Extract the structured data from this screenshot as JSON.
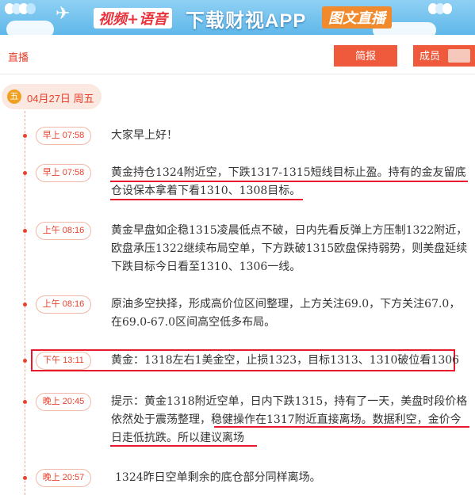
{
  "banner": {
    "slogan_left": "视频+语音",
    "slogan_main": "下载财视APP",
    "slogan_right": "图文直播",
    "plane_icon": "airplane-icon",
    "balloon_icon": "balloons-icon"
  },
  "header": {
    "title": "直播",
    "brief_button": "简报",
    "member_button": "成员"
  },
  "date": {
    "weekday_badge": "五",
    "date_text": "04月27日 周五"
  },
  "colors": {
    "accent": "#e8412c",
    "button_bg": "#f05a3c",
    "annotation_red": "#e8192c"
  },
  "entries": [
    {
      "time": "早上 07:58",
      "text": "大家早上好！"
    },
    {
      "time": "早上 07:58",
      "text": "黄金持仓1324附近空，下跌1317-1315短线目标止盈。持有的金友留底仓设保本拿着下看1310、1308目标。"
    },
    {
      "time": "上午 08:16",
      "text": "黄金早盘如企稳1315凌晨低点不破，日内先看反弹上方压制1322附近，欧盘承压1322继续布局空单，下方跌破1315欧盘保持弱势，则美盘延续下跌目标今日看至1310、1306一线。"
    },
    {
      "time": "上午 08:16",
      "text": "原油多空抉择，形成高价位区间整理，上方关注69.0，下方关注67.0，在69.0-67.0区间高空低多布局。"
    },
    {
      "time": "下午 13:11",
      "text": "黄金：1318左右1美金空，止损1323，目标1313、1310破位看1306"
    },
    {
      "time": "晚上 20:45",
      "text": "提示：黄金1318附近空单，日内下跌1315，持有了一天，美盘时段价格依然处于震荡整理，稳健操作在1317附近直接离场。数据利空，金价今日走低抗跌。所以建议离场"
    },
    {
      "time": "晚上 20:57",
      "text": "1324昨日空单剩余的底仓部分同样离场。"
    }
  ]
}
